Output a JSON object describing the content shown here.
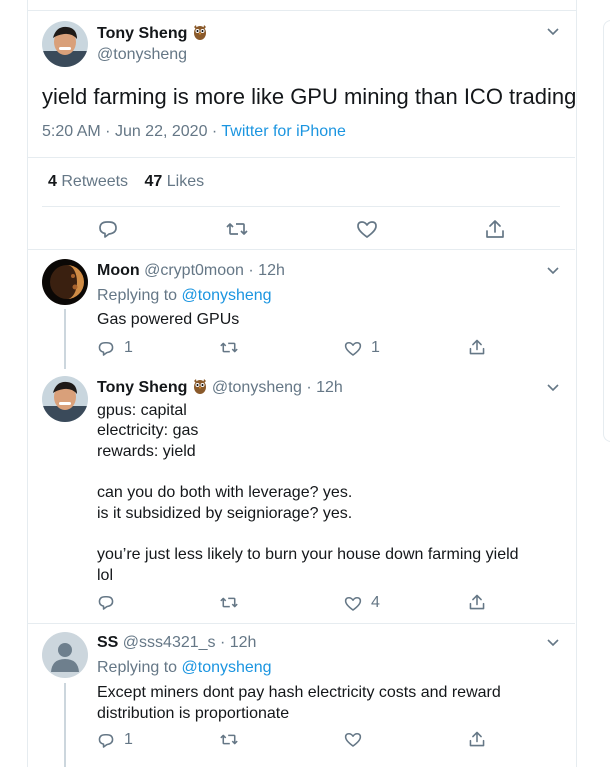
{
  "main_tweet": {
    "author_name": "Tony Sheng",
    "author_handle": "@tonysheng",
    "text": "yield farming is more like GPU mining than ICO trading",
    "time": "5:20 AM",
    "date": "Jun 22, 2020",
    "dot": "·",
    "source": "Twitter for iPhone",
    "retweet_count": "4",
    "retweets_label": "Retweets",
    "like_count": "47",
    "likes_label": "Likes"
  },
  "replies": [
    {
      "author_name": "Moon",
      "author_handle": "@crypt0moon",
      "meta": "· 12h",
      "replying_prefix": "Replying to ",
      "replying_to": "@tonysheng",
      "text": "Gas powered GPUs",
      "reply_count": "1",
      "like_count": "1"
    },
    {
      "author_name": "Tony Sheng",
      "author_handle": "@tonysheng",
      "meta": "· 12h",
      "lines": [
        "gpus: capital",
        "electricity: gas",
        "rewards: yield",
        "",
        "can you do both with leverage? yes.",
        "is it subsidized by seigniorage? yes.",
        "",
        "you’re just less likely to burn your house down farming yield",
        "lol"
      ],
      "like_count": "4"
    },
    {
      "author_name": "SS",
      "author_handle": "@sss4321_s",
      "meta": "· 12h",
      "replying_prefix": "Replying to ",
      "replying_to": "@tonysheng",
      "lines": [
        "Except miners dont pay hash electricity costs and reward",
        "distribution is proportionate"
      ],
      "reply_count": "1"
    }
  ],
  "colors": {
    "accent": "#1b95e0",
    "muted": "#657786",
    "text": "#14171a",
    "border": "#e6ecf0"
  },
  "icons": [
    "owl-emoji-icon",
    "chevron-down-icon",
    "reply-icon",
    "retweet-icon",
    "like-icon",
    "share-icon"
  ]
}
